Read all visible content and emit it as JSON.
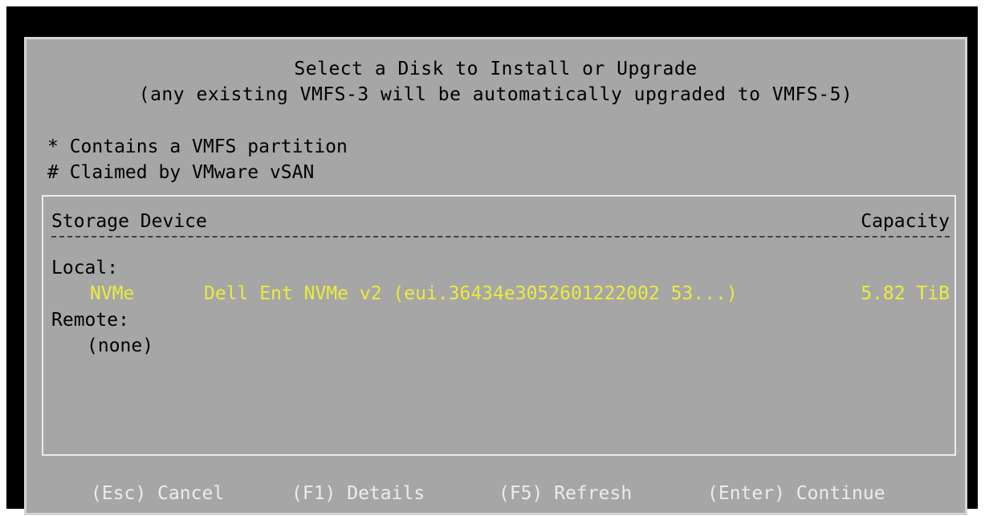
{
  "dialog": {
    "title": "Select a Disk to Install or Upgrade",
    "subtitle": "(any existing VMFS-3 will be automatically upgraded to VMFS-5)",
    "legend": [
      "* Contains a VMFS partition",
      "# Claimed by VMware vSAN"
    ]
  },
  "table": {
    "col_device": "Storage Device",
    "col_capacity": "Capacity",
    "local_label": "Local:",
    "remote_label": "Remote:",
    "rows": [
      {
        "type": "NVMe",
        "name": "Dell Ent NVMe v2 (eui.36434e3052601222002 53...)",
        "capacity": "5.82 TiB"
      }
    ],
    "remote_none": "(none)"
  },
  "keys": [
    "(Esc) Cancel",
    "(F1) Details",
    "(F5) Refresh",
    "(Enter) Continue"
  ],
  "colors": {
    "background": "#a6a6a6",
    "highlight": "#ecec3c",
    "key_text": "#ececec"
  }
}
